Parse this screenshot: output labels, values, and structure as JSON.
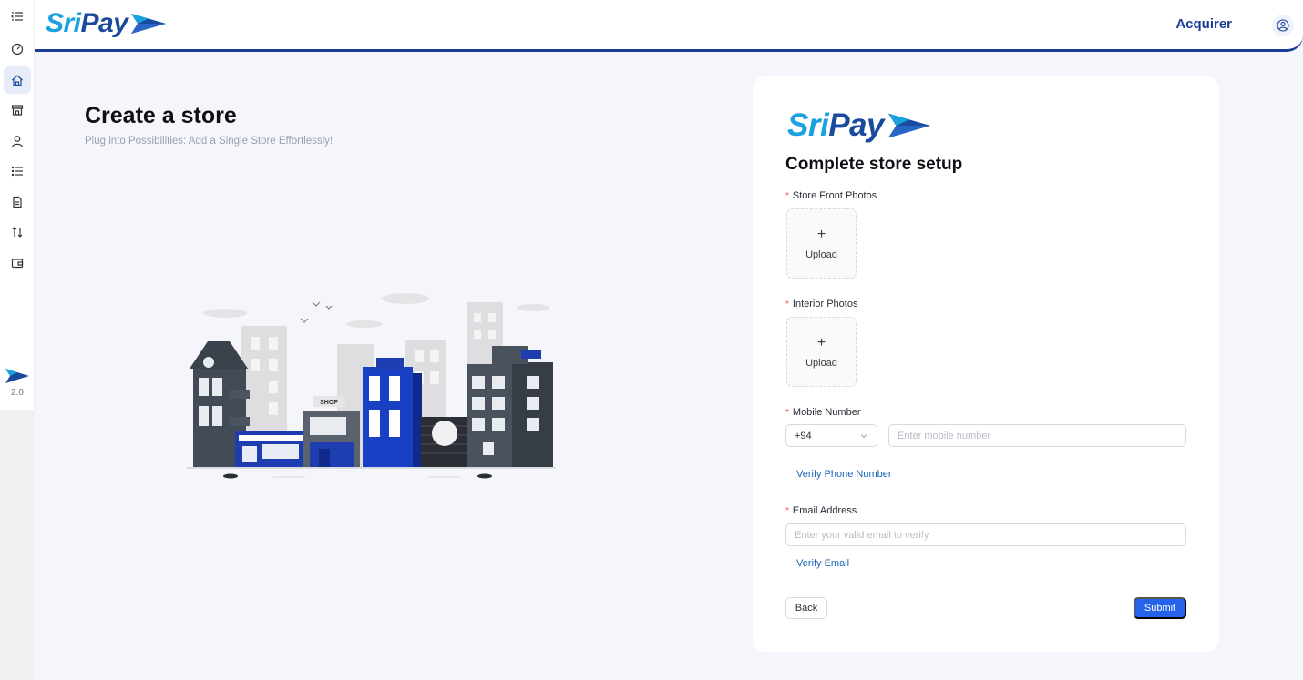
{
  "brand": {
    "name_part1": "Sri",
    "name_part2": "Pay"
  },
  "sidebar": {
    "items": [
      {
        "icon": "menu-fold-icon"
      },
      {
        "icon": "dashboard-icon"
      },
      {
        "icon": "home-icon",
        "active": true
      },
      {
        "icon": "store-icon"
      },
      {
        "icon": "user-icon"
      },
      {
        "icon": "list-icon"
      },
      {
        "icon": "document-icon"
      },
      {
        "icon": "transfer-icon"
      },
      {
        "icon": "wallet-icon"
      }
    ],
    "version": "2.0"
  },
  "header": {
    "role": "Acquirer",
    "avatar_icon": "user-circle-icon"
  },
  "page": {
    "title": "Create a store",
    "subtitle": "Plug into Possibilities: Add a Single Store Effortlessly!",
    "illustration_label": "SHOP"
  },
  "form": {
    "title": "Complete store setup",
    "store_front": {
      "label": "Store Front Photos",
      "upload_label": "Upload"
    },
    "interior": {
      "label": "Interior Photos",
      "upload_label": "Upload"
    },
    "mobile": {
      "label": "Mobile Number",
      "country_code": "+94",
      "placeholder": "Enter mobile number",
      "verify_label": "Verify Phone Number"
    },
    "email": {
      "label": "Email Address",
      "placeholder": "Enter your valid email to verify",
      "verify_label": "Verify Email"
    },
    "back_label": "Back",
    "submit_label": "Submit"
  },
  "colors": {
    "primary": "#1a3c94",
    "accent": "#1aa1df",
    "submit": "#2563eb",
    "required": "#ff4d4f"
  }
}
